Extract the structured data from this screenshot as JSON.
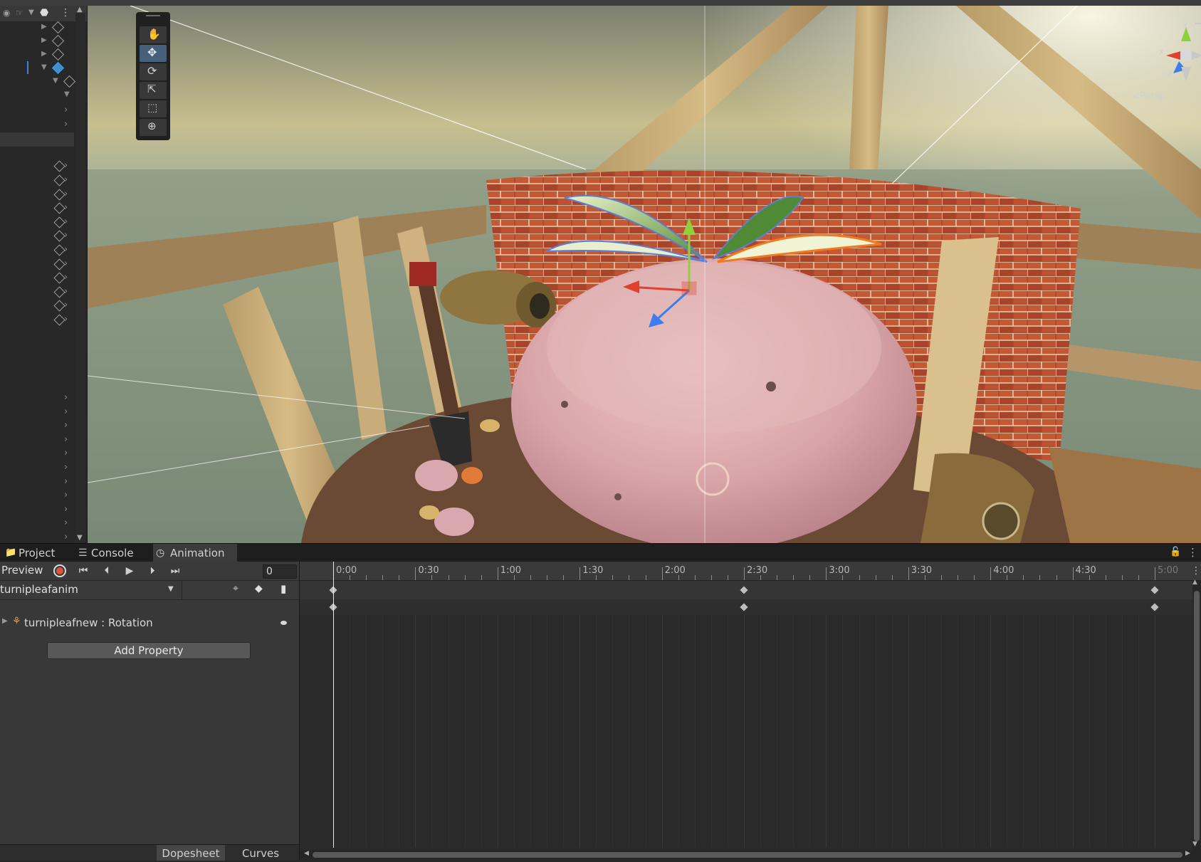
{
  "tabs": [
    {
      "label": "Project",
      "icon": "folder-icon"
    },
    {
      "label": "Console",
      "icon": "console-icon"
    },
    {
      "label": "Animation",
      "icon": "clock-icon"
    }
  ],
  "animation": {
    "preview_label": "Preview",
    "frame_value": "0",
    "clip_name": "turnipleafanim",
    "property_label": "turnipleafnew : Rotation",
    "add_property_label": "Add Property",
    "mode_dopesheet": "Dopesheet",
    "mode_curves": "Curves",
    "timeline_labels": [
      "0:00",
      "0:30",
      "1:00",
      "1:30",
      "2:00",
      "2:30",
      "3:00",
      "3:30",
      "4:00",
      "4:30",
      "5:00"
    ],
    "keyframe_times": [
      "0:00",
      "2:30",
      "5:00"
    ],
    "record_color": "#e0503c"
  },
  "scene": {
    "view_mode": "Persp",
    "gizmo_axes": [
      "y",
      "x",
      "z"
    ],
    "axis_colors": {
      "x": "#e0402c",
      "y": "#8ed13c",
      "z": "#3b7ef0"
    }
  }
}
